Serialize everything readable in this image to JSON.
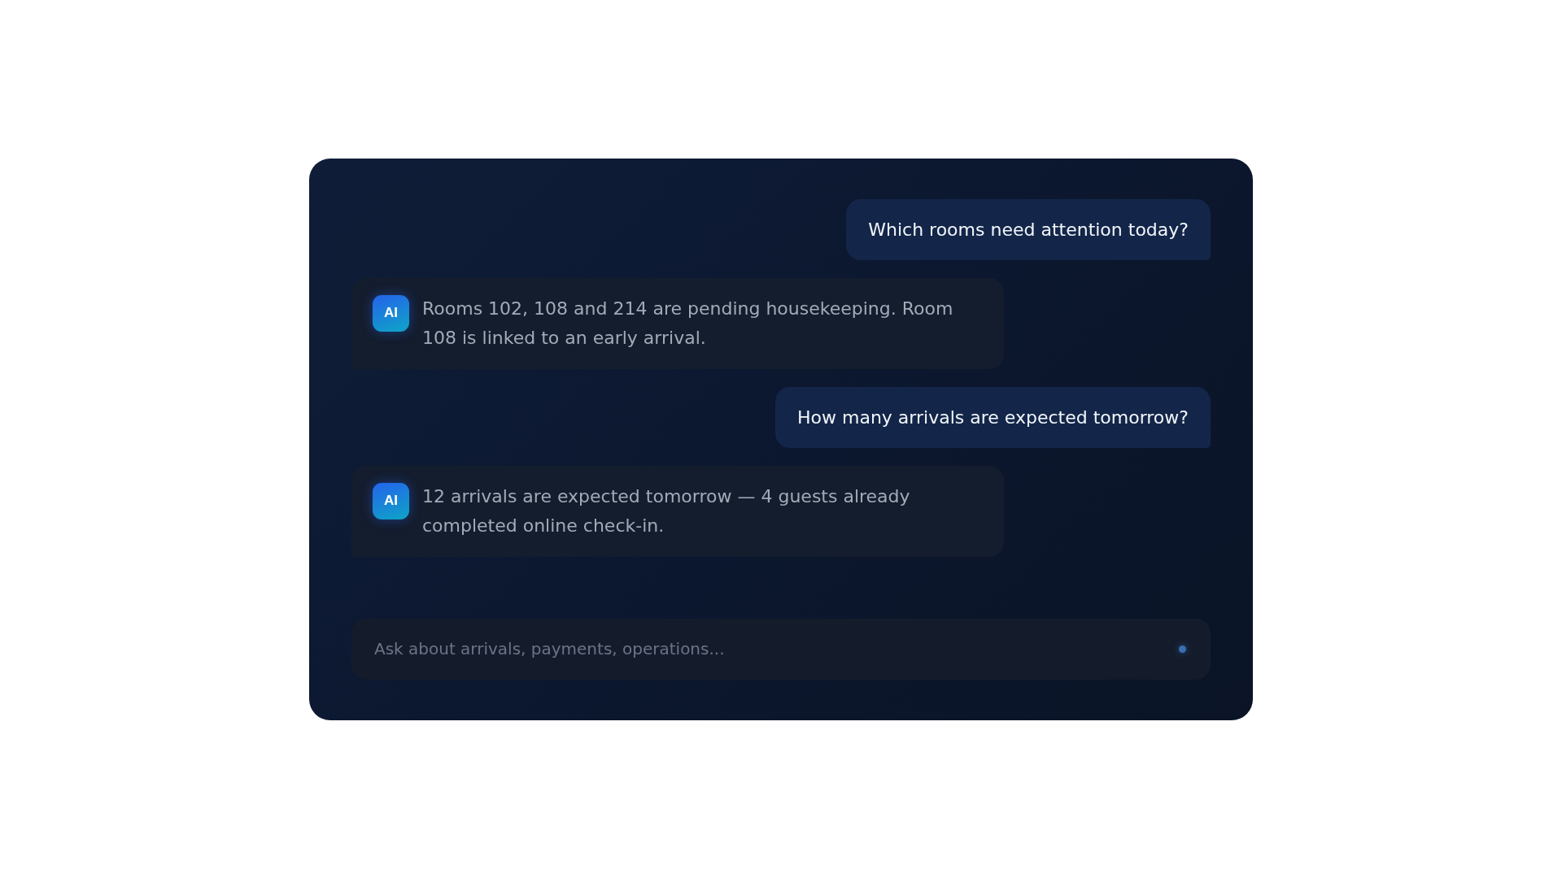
{
  "messages": [
    {
      "kind": "user",
      "text": "Which rooms need attention today?"
    },
    {
      "kind": "assistant",
      "avatar": "AI",
      "text": "Rooms 102, 108 and 214 are pending housekeeping. Room 108 is linked to an early arrival."
    },
    {
      "kind": "user",
      "text": "How many arrivals are expected tomorrow?"
    },
    {
      "kind": "assistant",
      "avatar": "AI",
      "text": "12 arrivals are expected tomorrow — 4 guests already completed online check-in."
    }
  ],
  "composer": {
    "placeholder": "Ask about arrivals, payments, operations..."
  }
}
